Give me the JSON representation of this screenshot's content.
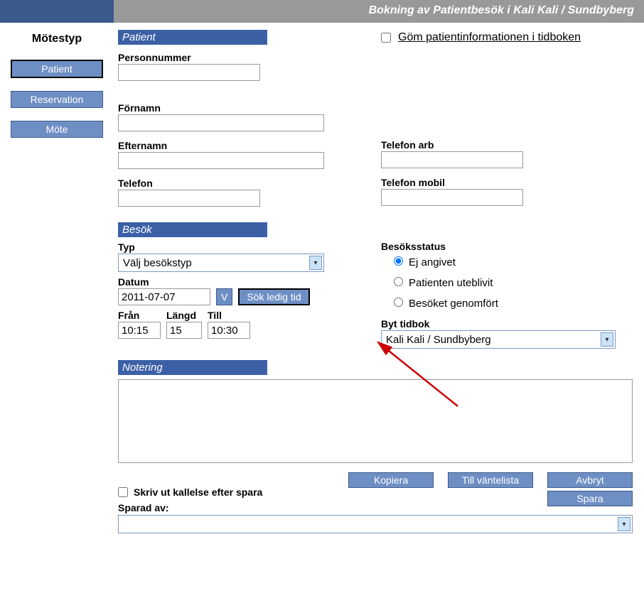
{
  "header": {
    "title": "Bokning av Patientbesök  i Kali Kali / Sundbyberg"
  },
  "sidebar": {
    "title": "Mötestyp",
    "items": [
      {
        "label": "Patient",
        "active": true
      },
      {
        "label": "Reservation",
        "active": false
      },
      {
        "label": "Möte",
        "active": false
      }
    ]
  },
  "patient": {
    "section": "Patient",
    "hide_label": "Göm patientinformationen i tidboken",
    "personnummer_label": "Personnummer",
    "personnummer": "",
    "fornamn_label": "Förnamn",
    "fornamn": "",
    "efternamn_label": "Efternamn",
    "efternamn": "",
    "telefon_label": "Telefon",
    "telefon": "",
    "telefon_arb_label": "Telefon arb",
    "telefon_arb": "",
    "telefon_mobil_label": "Telefon mobil",
    "telefon_mobil": ""
  },
  "visit": {
    "section": "Besök",
    "typ_label": "Typ",
    "typ_value": "Välj besökstyp",
    "datum_label": "Datum",
    "datum": "2011-07-07",
    "v_button": "V",
    "search_button": "Sök ledig tid",
    "fran_label": "Från",
    "fran": "10:15",
    "langd_label": "Längd",
    "langd": "15",
    "till_label": "Till",
    "till": "10:30",
    "status_label": "Besöksstatus",
    "status_options": [
      "Ej angivet",
      "Patienten uteblivit",
      "Besöket genomfört"
    ],
    "byt_tidbok_label": "Byt tidbok",
    "byt_tidbok_value": "Kali Kali / Sundbyberg"
  },
  "notes": {
    "section": "Notering",
    "value": ""
  },
  "actions": {
    "kopiera": "Kopiera",
    "till_vantelista": "Till väntelista",
    "avbryt": "Avbryt",
    "spara": "Spara"
  },
  "footer": {
    "print_label": "Skriv ut kallelse efter spara",
    "sparad_av_label": "Sparad av:",
    "sparad_av_value": ""
  }
}
